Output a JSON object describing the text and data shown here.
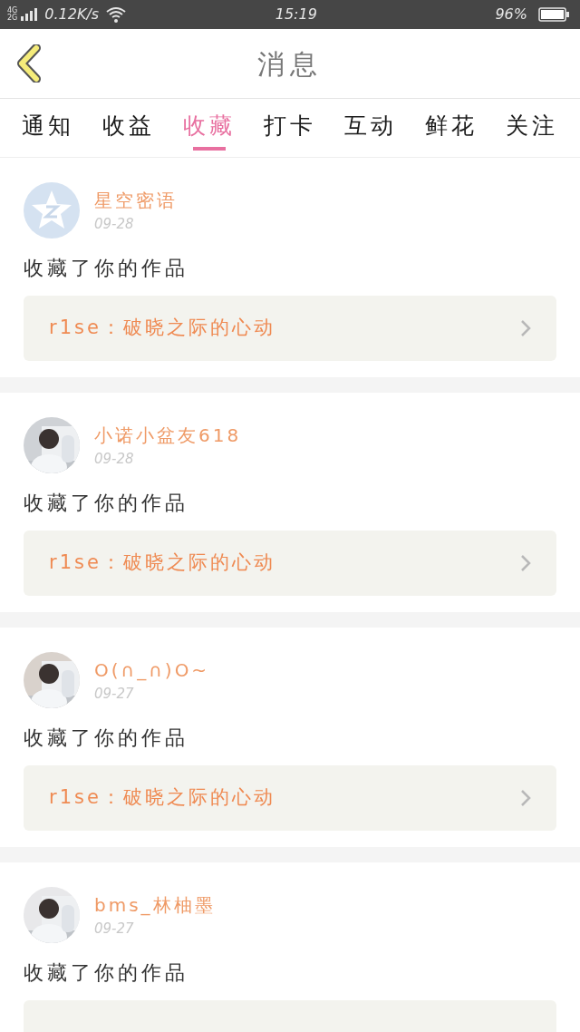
{
  "status_bar": {
    "network_top": "4G",
    "network_bottom": "2G",
    "speed": "0.12K/s",
    "time": "15:19",
    "battery": "96%"
  },
  "header": {
    "title": "消息"
  },
  "tabs": [
    {
      "label": "通知",
      "selected": false
    },
    {
      "label": "收益",
      "selected": false
    },
    {
      "label": "收藏",
      "selected": true
    },
    {
      "label": "打卡",
      "selected": false
    },
    {
      "label": "互动",
      "selected": false
    },
    {
      "label": "鲜花",
      "selected": false
    },
    {
      "label": "关注",
      "selected": false
    }
  ],
  "messages": [
    {
      "avatar": {
        "kind": "logo"
      },
      "name": "星空密语",
      "date": "09-28",
      "action": "收藏了你的作品",
      "work": {
        "kind": "link",
        "title": "r1se：破晓之际的心动"
      }
    },
    {
      "name": "小诺小盆友618",
      "date": "09-28",
      "action": "收藏了你的作品",
      "work": {
        "kind": "link",
        "title": "r1se：破晓之际的心动"
      }
    },
    {
      "name": "O(∩_∩)O~",
      "date": "09-27",
      "action": "收藏了你的作品",
      "work": {
        "kind": "link",
        "title": "r1se：破晓之际的心动"
      }
    },
    {
      "name": "bms_林柚墨",
      "date": "09-27",
      "action": "收藏了你的作品",
      "work": {
        "kind": "link"
      }
    }
  ]
}
